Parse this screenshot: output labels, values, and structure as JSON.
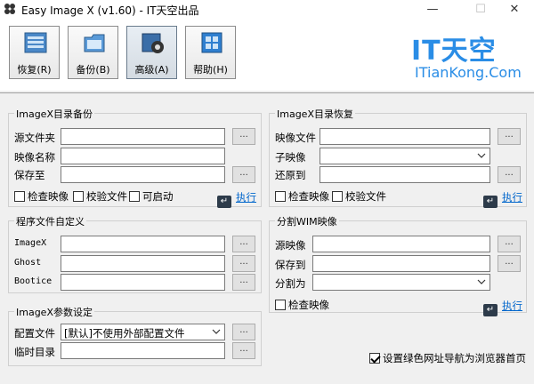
{
  "window": {
    "title": "Easy Image X (v1.60) - IT天空出品",
    "minimize": "—",
    "maximize": "☐",
    "close": "✕"
  },
  "toolbar": {
    "restore_label": "恢复(R)",
    "backup_label": "备份(B)",
    "advanced_label": "高级(A)",
    "help_label": "帮助(H)"
  },
  "logo": {
    "main": "IT天空",
    "sub": "ITianKong.Com",
    "color": "#2a8de6"
  },
  "backup_group": {
    "title": "ImageX目录备份",
    "source_label": "源文件夹",
    "source_value": "",
    "name_label": "映像名称",
    "name_value": "",
    "save_label": "保存至",
    "save_value": "",
    "check_image": "检查映像",
    "verify_files": "校验文件",
    "bootable": "可启动",
    "execute": "执行"
  },
  "restore_group": {
    "title": "ImageX目录恢复",
    "image_label": "映像文件",
    "image_value": "",
    "subimage_label": "子映像",
    "subimage_value": "",
    "restore_to_label": "还原到",
    "restore_to_value": "",
    "check_image": "检查映像",
    "verify_files": "校验文件",
    "execute": "执行"
  },
  "custom_group": {
    "title": "程序文件自定义",
    "imagex_label": "ImageX",
    "ghost_label": "Ghost",
    "bootice_label": "Bootice"
  },
  "split_group": {
    "title": "分割WIM映像",
    "source_label": "源映像",
    "save_label": "保存到",
    "split_label": "分割为",
    "split_value": "",
    "check_image": "检查映像",
    "execute": "执行"
  },
  "params_group": {
    "title": "ImageX参数设定",
    "config_label": "配置文件",
    "config_value": "[默认]不使用外部配置文件",
    "temp_label": "临时目录",
    "temp_value": ""
  },
  "browse_label": "...",
  "homepage_option": {
    "label": "设置绿色网址导航为浏览器首页",
    "checked": true
  }
}
